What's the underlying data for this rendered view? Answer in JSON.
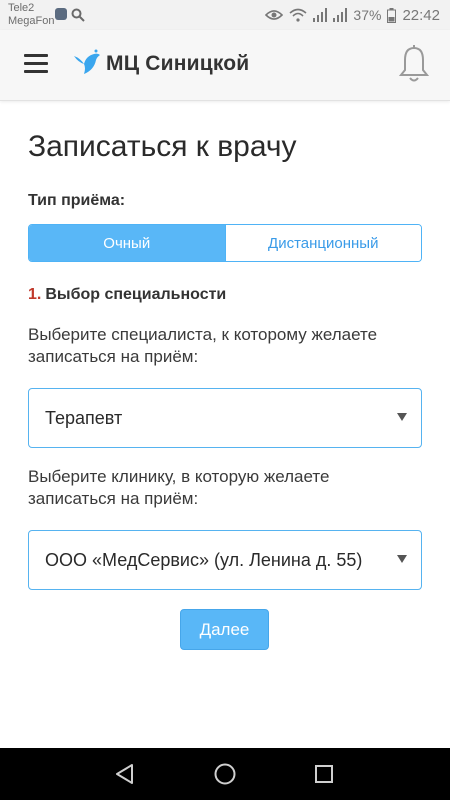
{
  "status_bar": {
    "carrier1": "Tele2",
    "carrier2": "MegaFon",
    "battery": "37%",
    "time": "22:42",
    "icons": [
      "eye-icon",
      "wifi-icon",
      "signal-icon",
      "signal-icon",
      "battery-icon"
    ]
  },
  "header": {
    "title": "МЦ Синицкой",
    "menu_icon": "hamburger-menu-icon",
    "logo_icon": "bird-logo-icon",
    "notifications_icon": "bell-icon"
  },
  "page": {
    "title": "Записаться к врачу",
    "appointment_type_label": "Тип приёма:",
    "appointment_types": [
      {
        "label": "Очный",
        "active": true
      },
      {
        "label": "Дистанционный",
        "active": false
      }
    ],
    "step_number": "1.",
    "step_title": "Выбор специальности",
    "specialist_prompt": "Выберите специалиста, к которому желаете записаться на приём:",
    "specialist_selected": "Терапевт",
    "clinic_prompt": "Выберите клинику, в которую желаете записаться на приём:",
    "clinic_selected": "ООО «МедСервис» (ул. Ленина д. 55)",
    "next_button": "Далее"
  },
  "colors": {
    "accent": "#59b7f7",
    "accent_border": "#4fb3f6",
    "step_number": "#c0392b",
    "navbar": "#000000"
  },
  "nav_bar": {
    "back_icon": "back-triangle-icon",
    "home_icon": "home-circle-icon",
    "recents_icon": "recents-square-icon"
  }
}
